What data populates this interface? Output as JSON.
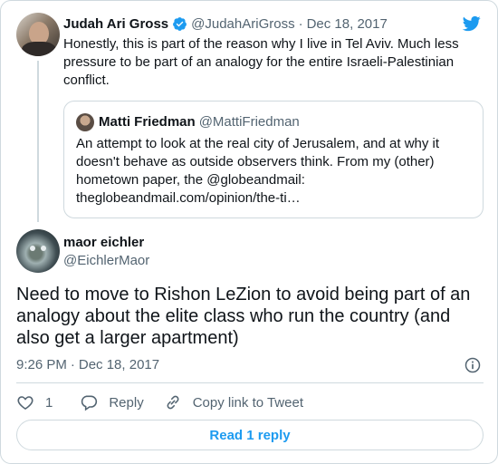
{
  "colors": {
    "accent": "#1d9bf0",
    "verified": "#1d9bf0",
    "muted": "#536471",
    "border": "#cfd9de"
  },
  "parent": {
    "name": "Judah Ari Gross",
    "handle": "@JudahAriGross",
    "separator": "·",
    "date": "Dec 18, 2017",
    "verified_icon": "verified-badge-icon",
    "text": "Honestly, this is part of the reason why I live in Tel Aviv. Much less pressure to be part of an analogy for the entire Israeli-Palestinian conflict."
  },
  "quote": {
    "name": "Matti Friedman",
    "handle": "@MattiFriedman",
    "text": "An attempt to look at the real city of Jerusalem, and at why it doesn't behave as outside observers think. From my (other) hometown paper, the @globeandmail: theglobeandmail.com/opinion/the-ti…"
  },
  "main": {
    "name": "maor eichler",
    "handle": "@EichlerMaor",
    "text": "Need to move to Rishon LeZion to avoid being part of an analogy about the elite class who run the country (and also get a larger apartment)",
    "time": "9:26 PM",
    "separator": "·",
    "date": "Dec 18, 2017"
  },
  "actions": {
    "like_count": "1",
    "reply_label": "Reply",
    "copy_label": "Copy link to Tweet"
  },
  "read_replies_label": "Read 1 reply"
}
